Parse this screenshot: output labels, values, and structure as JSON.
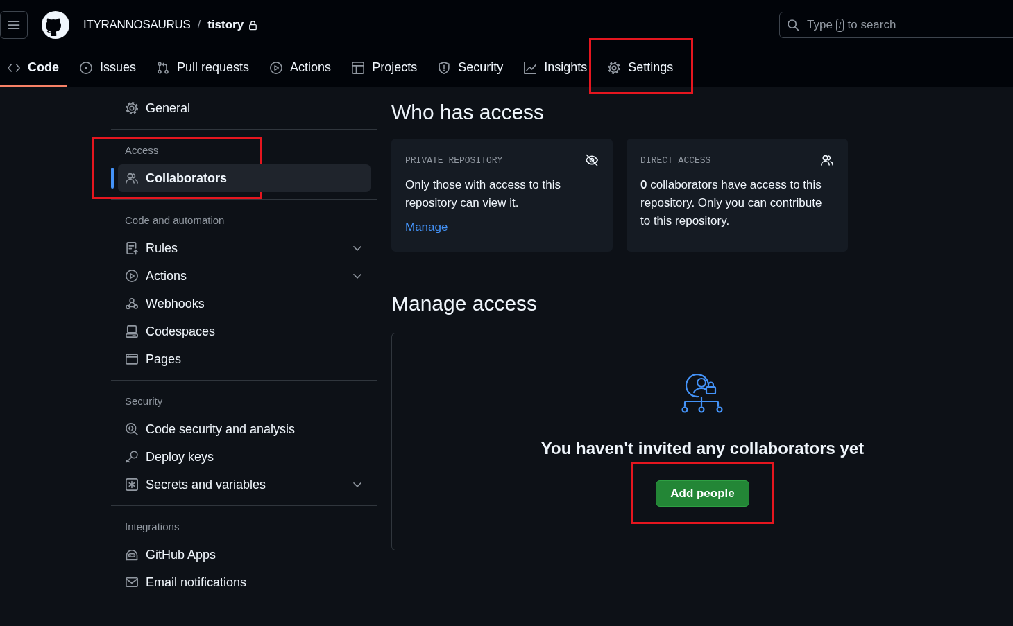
{
  "header": {
    "owner": "ITYRANNOSAURUS",
    "separator": "/",
    "repo": "tistory",
    "search": {
      "placeholder": "Type",
      "shortcut": "/",
      "placeholder_end": "to search"
    }
  },
  "tabs": [
    {
      "label": "Code",
      "selected": true,
      "highlighted": false
    },
    {
      "label": "Issues",
      "selected": false,
      "highlighted": false
    },
    {
      "label": "Pull requests",
      "selected": false,
      "highlighted": false
    },
    {
      "label": "Actions",
      "selected": false,
      "highlighted": false
    },
    {
      "label": "Projects",
      "selected": false,
      "highlighted": false
    },
    {
      "label": "Security",
      "selected": false,
      "highlighted": false
    },
    {
      "label": "Insights",
      "selected": false,
      "highlighted": false
    },
    {
      "label": "Settings",
      "selected": false,
      "highlighted": true
    }
  ],
  "sidebar": {
    "sections": [
      {
        "highlighted": false,
        "items": [
          {
            "label": "General",
            "selected": false,
            "expandable": false
          }
        ]
      },
      {
        "heading": "Access",
        "highlighted": true,
        "items": [
          {
            "label": "Collaborators",
            "selected": true,
            "expandable": false
          }
        ]
      },
      {
        "heading": "Code and automation",
        "highlighted": false,
        "items": [
          {
            "label": "Rules",
            "selected": false,
            "expandable": true
          },
          {
            "label": "Actions",
            "selected": false,
            "expandable": true
          },
          {
            "label": "Webhooks",
            "selected": false,
            "expandable": false
          },
          {
            "label": "Codespaces",
            "selected": false,
            "expandable": false
          },
          {
            "label": "Pages",
            "selected": false,
            "expandable": false
          }
        ]
      },
      {
        "heading": "Security",
        "highlighted": false,
        "items": [
          {
            "label": "Code security and analysis",
            "selected": false,
            "expandable": false
          },
          {
            "label": "Deploy keys",
            "selected": false,
            "expandable": false
          },
          {
            "label": "Secrets and variables",
            "selected": false,
            "expandable": true
          }
        ]
      },
      {
        "heading": "Integrations",
        "highlighted": false,
        "items": [
          {
            "label": "GitHub Apps",
            "selected": false,
            "expandable": false
          },
          {
            "label": "Email notifications",
            "selected": false,
            "expandable": false
          }
        ]
      }
    ]
  },
  "access": {
    "title": "Who has access",
    "cards": [
      {
        "label": "PRIVATE REPOSITORY",
        "text": "Only those with access to this repository can view it.",
        "link": "Manage"
      },
      {
        "label": "DIRECT ACCESS",
        "text": "**0** collaborators have access to this repository. Only you can contribute to this repository."
      }
    ]
  },
  "manage": {
    "title": "Manage access",
    "message": "You haven't invited any collaborators yet",
    "button": {
      "label": "Add people",
      "highlighted": true
    }
  }
}
